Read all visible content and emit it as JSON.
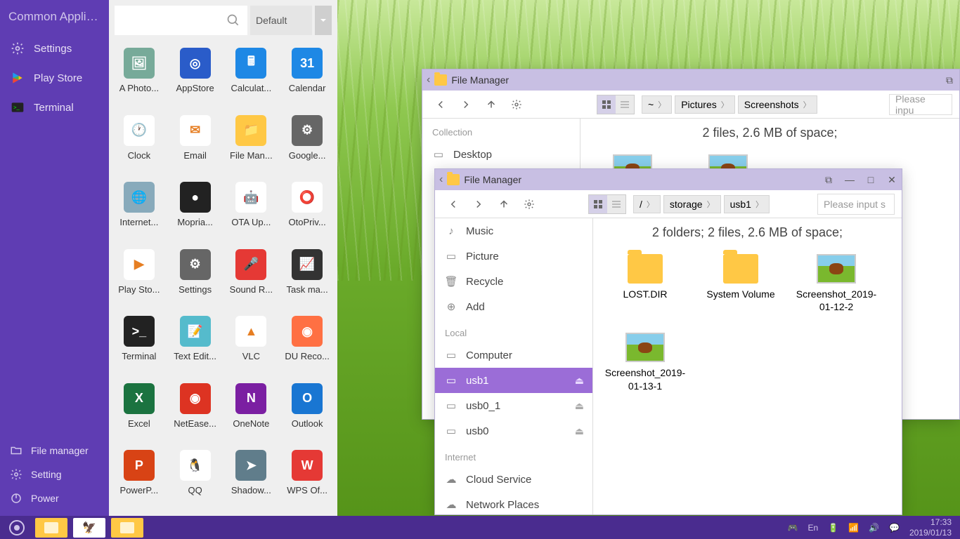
{
  "sidebar": {
    "header": "Common Applic...",
    "top_items": [
      {
        "label": "Settings",
        "name": "sidebar-item-settings",
        "icon": "gear"
      },
      {
        "label": "Play Store",
        "name": "sidebar-item-playstore",
        "icon": "play"
      },
      {
        "label": "Terminal",
        "name": "sidebar-item-terminal",
        "icon": "terminal"
      }
    ],
    "bottom_items": [
      {
        "label": "File manager",
        "name": "sidebar-item-filemanager",
        "icon": "folder"
      },
      {
        "label": "Setting",
        "name": "sidebar-item-setting",
        "icon": "gear"
      },
      {
        "label": "Power",
        "name": "sidebar-item-power",
        "icon": "power"
      }
    ]
  },
  "search": {
    "placeholder": "",
    "dropdown": "Default"
  },
  "apps": [
    {
      "label": "A Photo...",
      "bg": "#7a9",
      "glyph": "🖼"
    },
    {
      "label": "AppStore",
      "bg": "#2a5cc9",
      "glyph": "◎"
    },
    {
      "label": "Calculat...",
      "bg": "#1e88e5",
      "glyph": "🖩"
    },
    {
      "label": "Calendar",
      "bg": "#1e88e5",
      "glyph": "31"
    },
    {
      "label": "Clock",
      "bg": "#fff",
      "glyph": "🕐"
    },
    {
      "label": "Email",
      "bg": "#fff",
      "glyph": "✉"
    },
    {
      "label": "File Man...",
      "bg": "#ffc845",
      "glyph": "📁"
    },
    {
      "label": "Google...",
      "bg": "#666",
      "glyph": "⚙"
    },
    {
      "label": "Internet...",
      "bg": "#8ab",
      "glyph": "🌐"
    },
    {
      "label": "Mopria...",
      "bg": "#222",
      "glyph": "●"
    },
    {
      "label": "OTA Up...",
      "bg": "#fff",
      "glyph": "🤖"
    },
    {
      "label": "OtoPriv...",
      "bg": "#fff",
      "glyph": "⭕"
    },
    {
      "label": "Play Sto...",
      "bg": "#fff",
      "glyph": "▶"
    },
    {
      "label": "Settings",
      "bg": "#666",
      "glyph": "⚙"
    },
    {
      "label": "Sound R...",
      "bg": "#e53935",
      "glyph": "🎤"
    },
    {
      "label": "Task ma...",
      "bg": "#333",
      "glyph": "📈"
    },
    {
      "label": "Terminal",
      "bg": "#222",
      "glyph": ">_"
    },
    {
      "label": "Text Edit...",
      "bg": "#5bc",
      "glyph": "📝"
    },
    {
      "label": "VLC",
      "bg": "#fff",
      "glyph": "▲"
    },
    {
      "label": "DU Reco...",
      "bg": "#ff7043",
      "glyph": "◉"
    },
    {
      "label": "Excel",
      "bg": "#1b7340",
      "glyph": "X"
    },
    {
      "label": "NetEase...",
      "bg": "#d32",
      "glyph": "◉"
    },
    {
      "label": "OneNote",
      "bg": "#7b1fa2",
      "glyph": "N"
    },
    {
      "label": "Outlook",
      "bg": "#1976d2",
      "glyph": "O"
    },
    {
      "label": "PowerP...",
      "bg": "#d84315",
      "glyph": "P"
    },
    {
      "label": "QQ",
      "bg": "#fff",
      "glyph": "🐧"
    },
    {
      "label": "Shadow...",
      "bg": "#607d8b",
      "glyph": "➤"
    },
    {
      "label": "WPS Of...",
      "bg": "#e53935",
      "glyph": "W"
    }
  ],
  "fm1": {
    "title": "File Manager",
    "status": "2 files, 2.6 MB of space;",
    "search_placeholder": "Please inpu",
    "breadcrumb": [
      "~",
      "Pictures",
      "Screenshots"
    ],
    "sidebar": {
      "section": "Collection",
      "items": [
        "Desktop"
      ]
    }
  },
  "fm2": {
    "title": "File Manager",
    "status": "2 folders;   2 files, 2.6 MB of space;",
    "search_placeholder": "Please input s",
    "breadcrumb": [
      "/",
      "storage",
      "usb1"
    ],
    "sidebar": {
      "top_items": [
        "Music",
        "Picture",
        "Recycle",
        "Add"
      ],
      "section_local": "Local",
      "local_items": [
        "Computer",
        "usb1",
        "usb0_1",
        "usb0"
      ],
      "section_internet": "Internet",
      "internet_items": [
        "Cloud Service",
        "Network Places"
      ]
    },
    "files": [
      {
        "name": "LOST.DIR",
        "type": "folder"
      },
      {
        "name": "System Volume",
        "type": "folder"
      },
      {
        "name": "Screenshot_2019-01-12-2",
        "type": "image"
      },
      {
        "name": "Screenshot_2019-01-13-1",
        "type": "image"
      }
    ]
  },
  "taskbar": {
    "time": "17:33",
    "date": "2019/01/13",
    "lang": "En"
  }
}
